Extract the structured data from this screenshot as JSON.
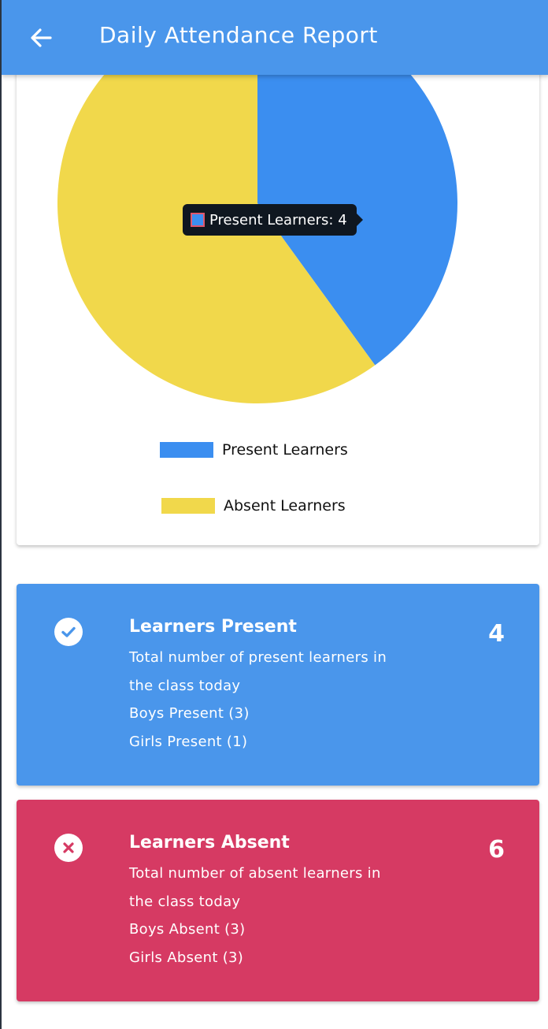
{
  "appbar": {
    "title": "Daily Attendance Report",
    "back_icon": "arrow-left-icon"
  },
  "colors": {
    "appbar": "#4a96eb",
    "present": "#3b8ef0",
    "absent": "#f1d84b",
    "present_card": "#4a96eb",
    "absent_card": "#d63a63"
  },
  "chart_data": {
    "type": "pie",
    "categories": [
      "Present Learners",
      "Absent Learners"
    ],
    "values": [
      4,
      6
    ],
    "colors": [
      "#3b8ef0",
      "#f1d84b"
    ],
    "legend_position": "bottom",
    "tooltip": "Present Learners: 4"
  },
  "legend": [
    {
      "label": "Present Learners"
    },
    {
      "label": "Absent Learners"
    }
  ],
  "present_card": {
    "icon": "check-circle-icon",
    "title": "Learners Present",
    "count": "4",
    "desc_line1": "Total number of present learners in",
    "desc_line2": "the class today",
    "boys": "Boys Present  (3)",
    "girls": "Girls Present (1)"
  },
  "absent_card": {
    "icon": "close-circle-icon",
    "title": "Learners Absent",
    "count": "6",
    "desc_line1": "Total number of absent learners in",
    "desc_line2": "the class today",
    "boys": "Boys Absent  (3)",
    "girls": "Girls Absent (3)"
  }
}
